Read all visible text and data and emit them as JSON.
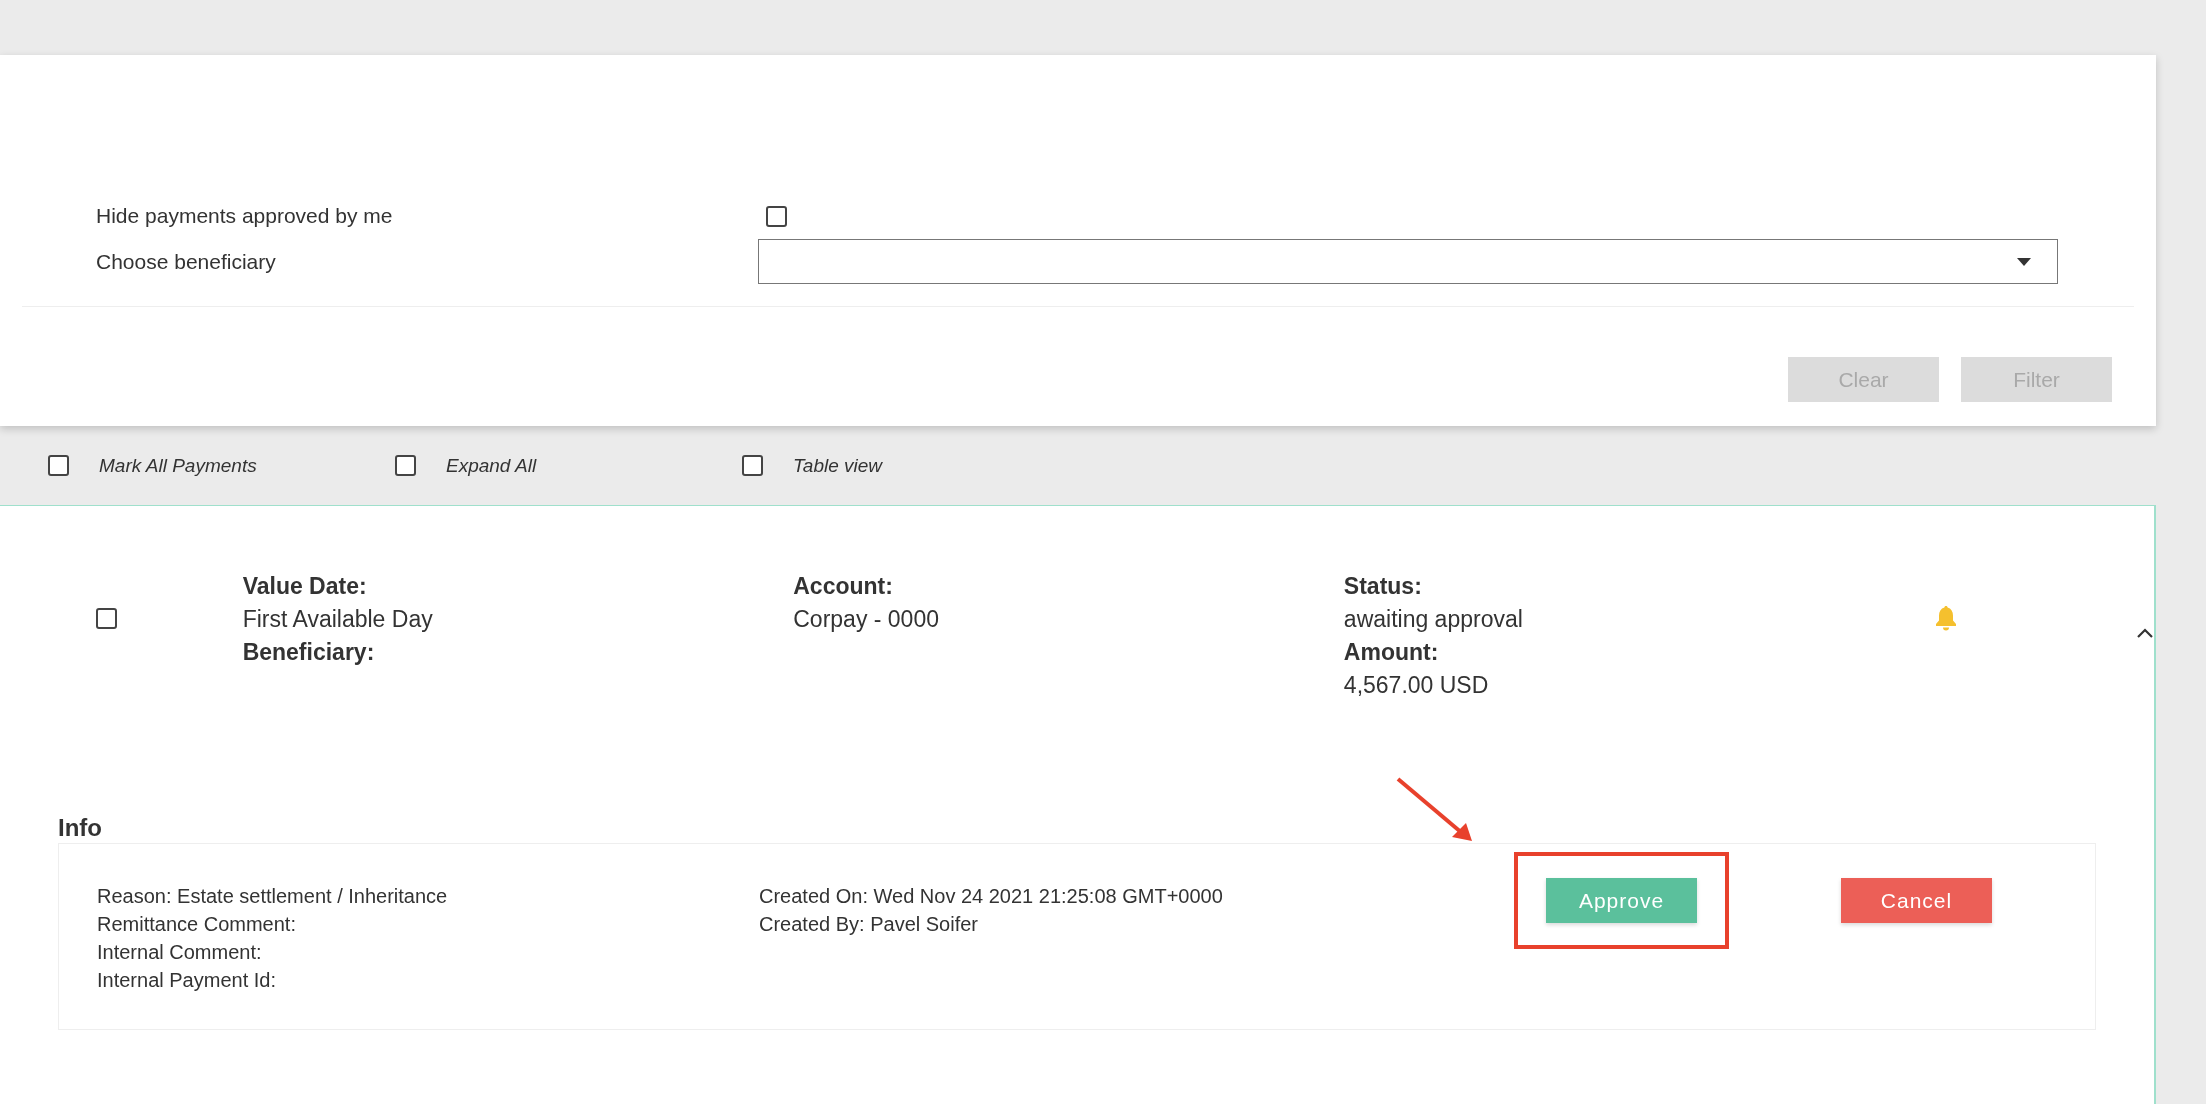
{
  "filters": {
    "fields": [
      {
        "kind": "checkbox",
        "label": "Hide payments approved by me",
        "checked": false
      },
      {
        "kind": "dropdown",
        "label": "Choose beneficiary"
      }
    ],
    "buttons": [
      {
        "label": "Clear",
        "disabled": true
      },
      {
        "label": "Filter",
        "disabled": true
      }
    ]
  },
  "toolbar": [
    {
      "label": "Mark All Payments",
      "checked": false
    },
    {
      "label": "Expand All",
      "checked": false
    },
    {
      "label": "Table view",
      "checked": false
    }
  ],
  "payment": {
    "checked": false,
    "expanded": true,
    "columns": [
      [
        {
          "label": "Value Date:",
          "value": "First Available Day"
        },
        {
          "label": "Beneficiary:"
        }
      ],
      [
        {
          "label": "Account:",
          "value": "Corpay - 0000"
        }
      ],
      [
        {
          "label": "Status:",
          "value": "awaiting approval"
        },
        {
          "label": "Amount:",
          "value": "4,567.00 USD"
        }
      ]
    ],
    "info": {
      "title": "Info",
      "details": [
        [
          "Reason: Estate settlement / Inheritance",
          "Remittance Comment:",
          "Internal Comment:",
          "Internal Payment Id:"
        ],
        [
          "Created On: Wed Nov 24 2021 21:25:08 GMT+0000",
          "Created By: Pavel Soifer"
        ]
      ],
      "actions": [
        {
          "kind": "approve",
          "label": "Approve",
          "highlighted": true
        },
        {
          "kind": "cancel",
          "label": "Cancel",
          "highlighted": false
        }
      ]
    }
  }
}
